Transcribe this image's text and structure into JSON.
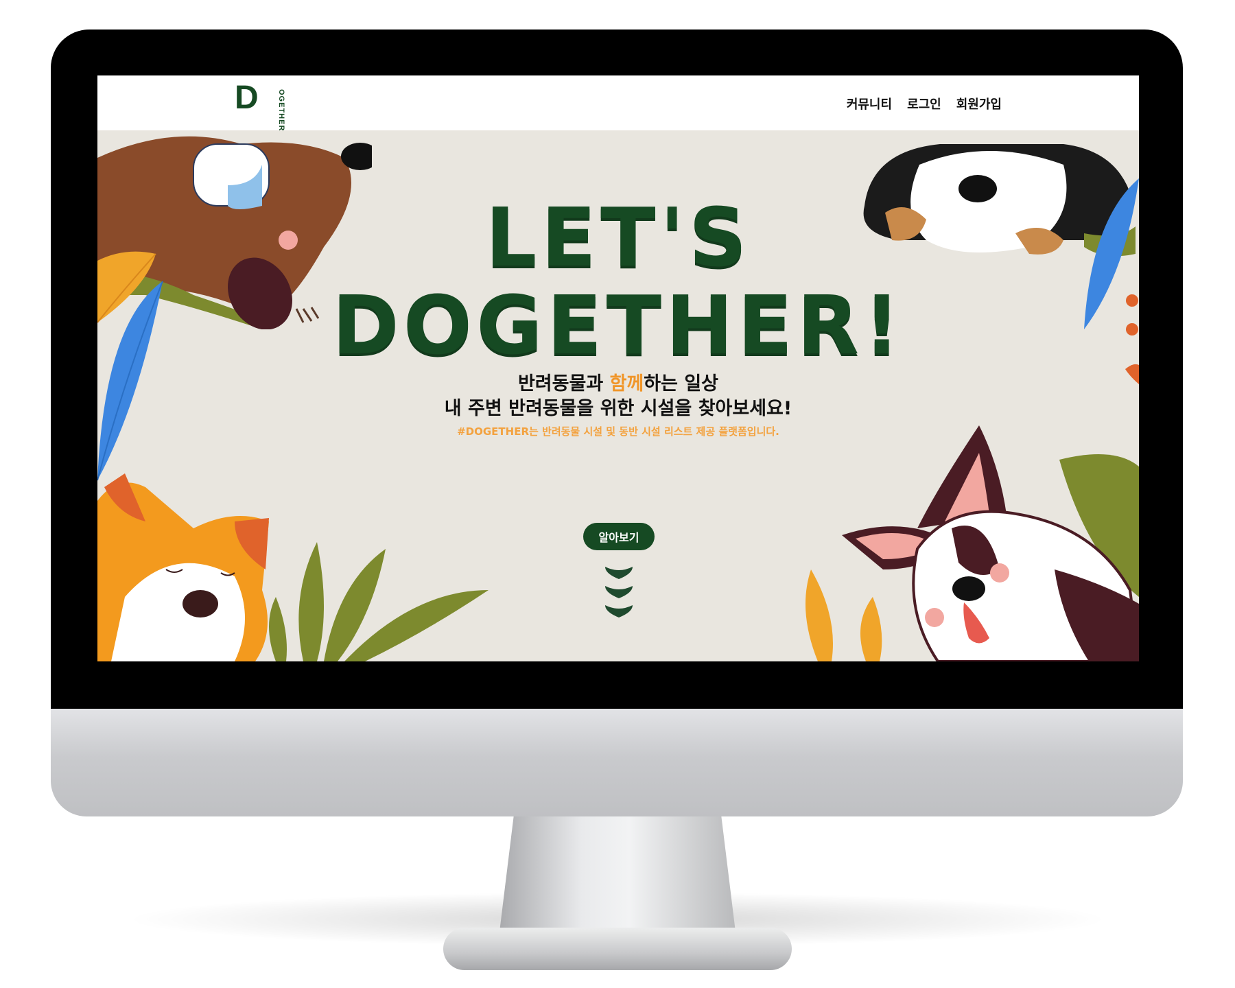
{
  "navbar": {
    "logo_letter": "D",
    "logo_arc_text": "OGETHER",
    "links": [
      {
        "label": "커뮤니티"
      },
      {
        "label": "로그인"
      },
      {
        "label": "회원가입"
      }
    ]
  },
  "hero": {
    "title_line1": "LET'S",
    "title_line2": "DOGETHER!",
    "subtitle_line1_before": "반려동물과 ",
    "subtitle_line1_accent": "함께",
    "subtitle_line1_after": "하는 일상",
    "subtitle_line2": "내 주변 반려동물을 위한 시설을 찾아보세요!",
    "tagline": "#DOGETHER는 반려동물 시설 및 동반 시설 리스트 제공 플랫폼입니다.",
    "cta_label": "알아보기"
  },
  "icons": {
    "scroll_indicator": "chevron-down-icon"
  },
  "colors": {
    "brand_green": "#164a23",
    "accent_orange": "#f0962a",
    "hero_background": "#e9e6df"
  }
}
